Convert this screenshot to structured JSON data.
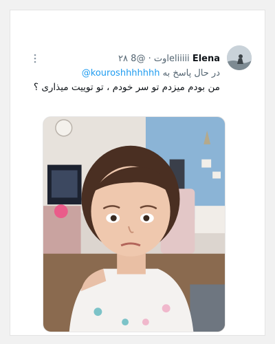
{
  "tweet": {
    "display_name": "Elena",
    "handle": "@8eliiiii",
    "date": "۲۸ اوت",
    "separator": "·",
    "reply_prefix": "در حال پاسخ به",
    "reply_to": "@kouroshhhhhhh",
    "text": "من بودم میزدم تو سر خودم ، تو توییت میذاری ؟"
  },
  "icons": {
    "more": "more-icon",
    "avatar": "avatar"
  },
  "colors": {
    "link": "#1d9bf0",
    "secondary_text": "#536471",
    "primary_text": "#0f1419"
  }
}
